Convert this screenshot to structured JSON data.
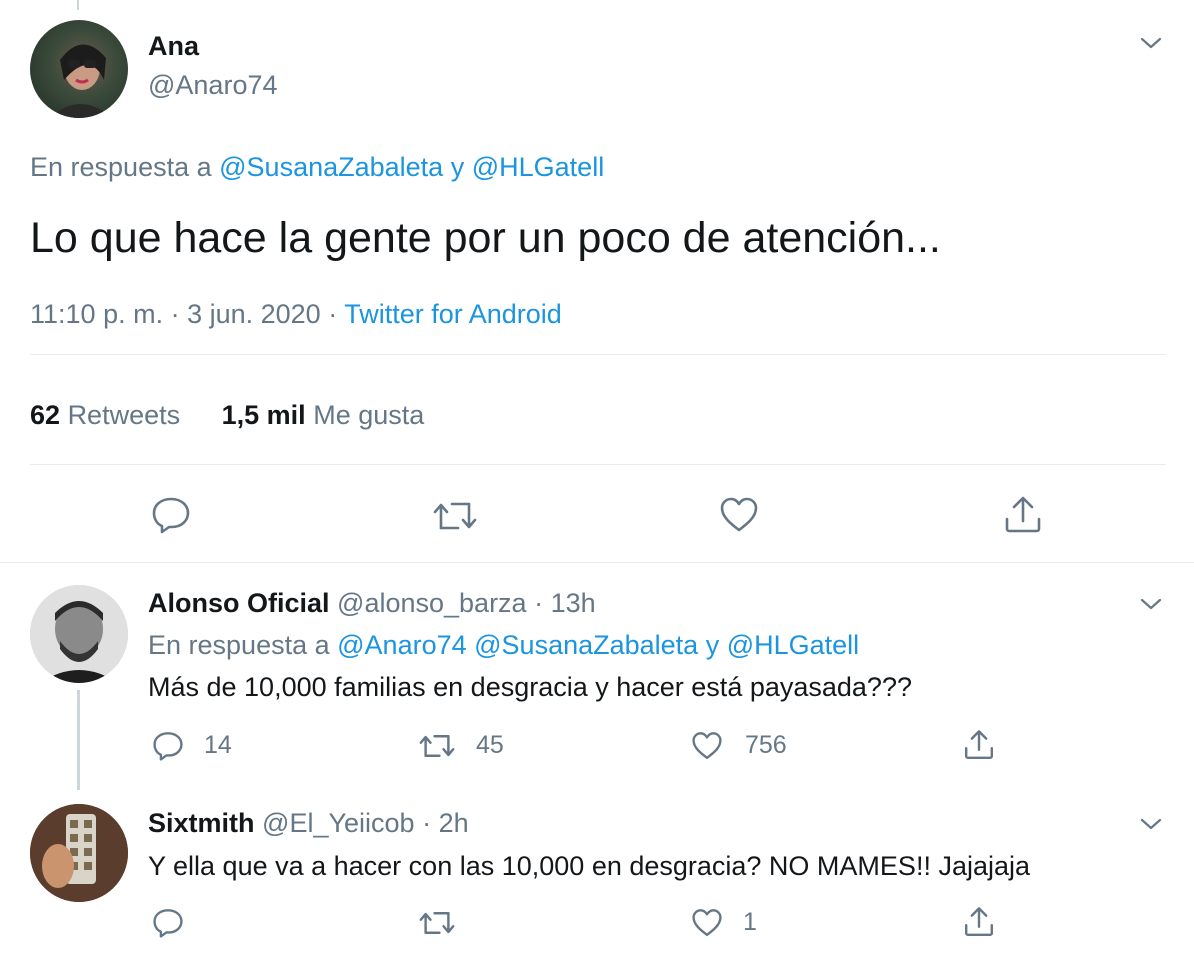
{
  "main_tweet": {
    "name": "Ana",
    "handle": "@Anaro74",
    "reply_prefix": "En respuesta a",
    "reply_mention_1": "@SusanaZabaleta",
    "reply_and": "y",
    "reply_mention_2": "@HLGatell",
    "text": "Lo que hace la gente por un poco de atención...",
    "time": "11:10 p. m. · 3 jun. 2020",
    "separator": "·",
    "source": "Twitter for Android",
    "retweets_count": "62",
    "retweets_label": "Retweets",
    "likes_count": "1,5 mil",
    "likes_label": "Me gusta"
  },
  "replies": [
    {
      "name": "Alonso Oficial",
      "handle": "@alonso_barza",
      "separator": "·",
      "time": "13h",
      "reply_prefix": "En respuesta a",
      "reply_mentions": "@Anaro74 @SusanaZabaleta",
      "reply_and": "y",
      "reply_mention_last": "@HLGatell",
      "text": "Más de 10,000 familias en desgracia y hacer está payasada???",
      "reply_count": "14",
      "retweet_count": "45",
      "like_count": "756"
    },
    {
      "name": "Sixtmith",
      "handle": "@El_Yeiicob",
      "separator": "·",
      "time": "2h",
      "text": "Y ella que va a hacer con las 10,000 en desgracia? NO MAMES!! Jajajaja",
      "reply_count": "",
      "retweet_count": "",
      "like_count": "1"
    }
  ],
  "colors": {
    "text": "#14171a",
    "secondary": "#657786",
    "link": "#1b95e0",
    "divider": "#e6ecf0"
  }
}
